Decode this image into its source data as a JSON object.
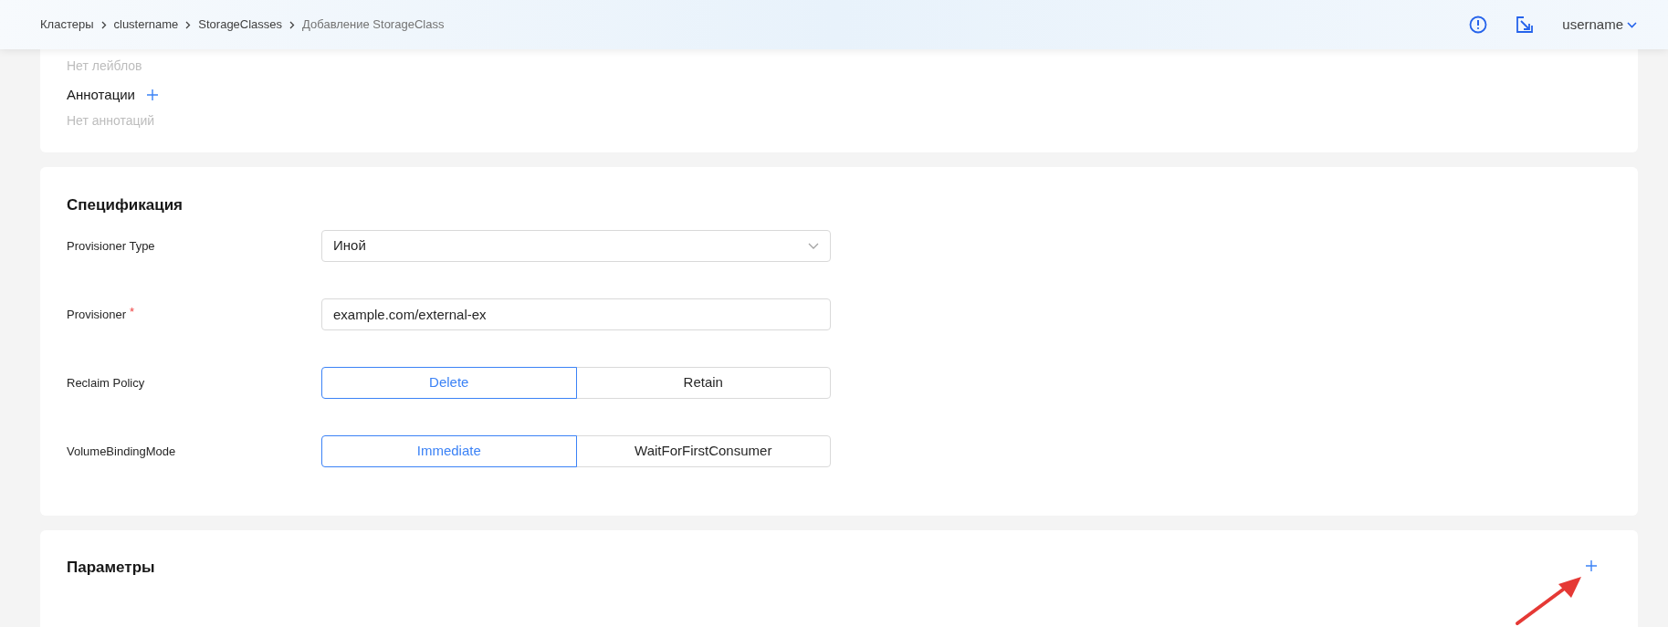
{
  "breadcrumbs": [
    {
      "label": "Кластеры",
      "current": false
    },
    {
      "label": "clustername",
      "current": false
    },
    {
      "label": "StorageClasses",
      "current": false
    },
    {
      "label": "Добавление StorageClass",
      "current": true
    }
  ],
  "user": {
    "name": "username"
  },
  "metadata": {
    "labels_empty": "Нет лейблов",
    "annotations_title": "Аннотации",
    "annotations_empty": "Нет аннотаций"
  },
  "spec": {
    "title": "Спецификация",
    "required_mark": "*",
    "fields": [
      {
        "kind": "select",
        "label": "Provisioner Type",
        "required": false,
        "value": "Иной"
      },
      {
        "kind": "input",
        "label": "Provisioner",
        "required": true,
        "value": "example.com/external-ex"
      },
      {
        "kind": "segmented",
        "label": "Reclaim Policy",
        "required": false,
        "options": [
          {
            "label": "Delete",
            "selected": true
          },
          {
            "label": "Retain",
            "selected": false
          }
        ]
      },
      {
        "kind": "segmented",
        "label": "VolumeBindingMode",
        "required": false,
        "options": [
          {
            "label": "Immediate",
            "selected": true
          },
          {
            "label": "WaitForFirstConsumer",
            "selected": false
          }
        ]
      }
    ]
  },
  "parameters": {
    "title": "Параметры"
  }
}
